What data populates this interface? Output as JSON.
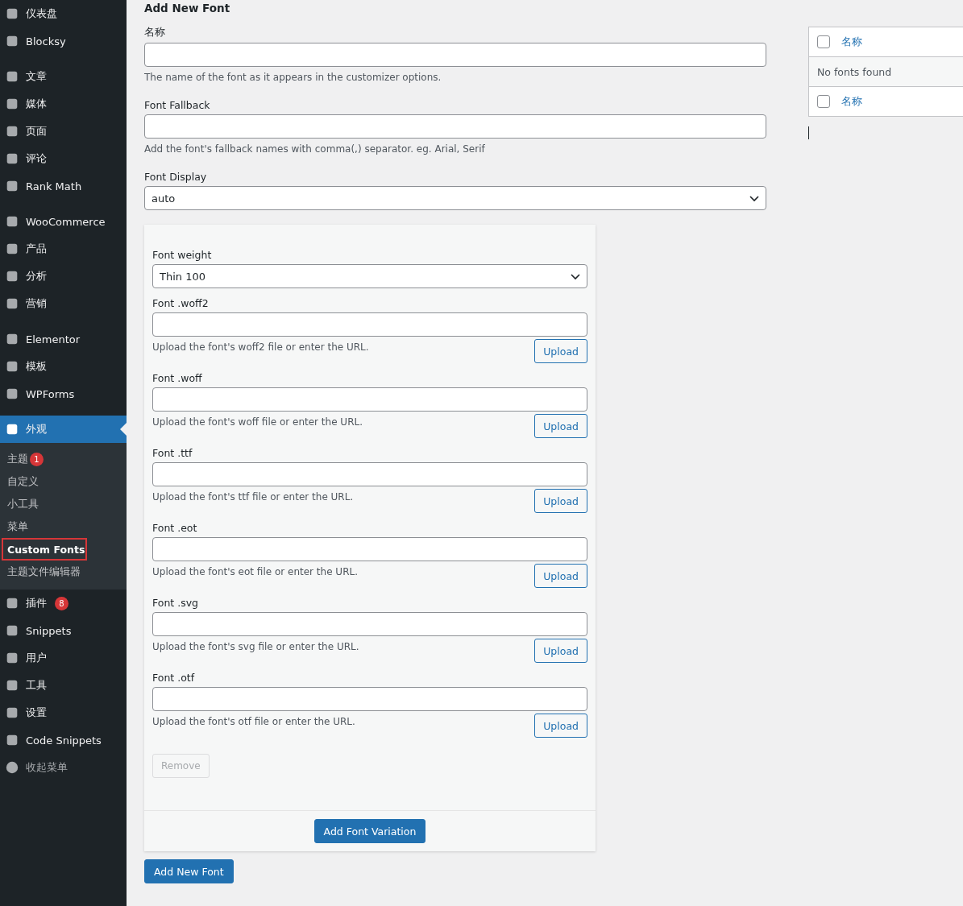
{
  "sidebar": {
    "groups": [
      [
        {
          "label": "仪表盘",
          "selected": false
        },
        {
          "label": "Blocksy",
          "selected": false
        }
      ],
      [
        {
          "label": "文章",
          "selected": false
        },
        {
          "label": "媒体",
          "selected": false
        },
        {
          "label": "页面",
          "selected": false
        },
        {
          "label": "评论",
          "selected": false
        },
        {
          "label": "Rank Math",
          "selected": false
        }
      ],
      [
        {
          "label": "WooCommerce",
          "selected": false
        },
        {
          "label": "产品",
          "selected": false
        },
        {
          "label": "分析",
          "selected": false
        },
        {
          "label": "营销",
          "selected": false
        }
      ],
      [
        {
          "label": "Elementor",
          "selected": false
        },
        {
          "label": "模板",
          "selected": false
        },
        {
          "label": "WPForms",
          "selected": false
        }
      ],
      [
        {
          "label": "外观",
          "selected": true,
          "children": [
            {
              "label": "主题",
              "badge": "1",
              "selected": false,
              "highlighted": false
            },
            {
              "label": "自定义",
              "selected": false,
              "highlighted": false
            },
            {
              "label": "小工具",
              "selected": false,
              "highlighted": false
            },
            {
              "label": "菜单",
              "selected": false,
              "highlighted": false
            },
            {
              "label": "Custom Fonts",
              "selected": true,
              "highlighted": true
            },
            {
              "label": "主题文件编辑器",
              "selected": false,
              "highlighted": false
            }
          ]
        },
        {
          "label": "插件",
          "badge": "8",
          "selected": false
        },
        {
          "label": "Snippets",
          "selected": false
        },
        {
          "label": "用户",
          "selected": false
        },
        {
          "label": "工具",
          "selected": false
        },
        {
          "label": "设置",
          "selected": false
        },
        {
          "label": "Code Snippets",
          "selected": false
        },
        {
          "label": "收起菜单",
          "selected": false,
          "muted": true
        }
      ]
    ]
  },
  "form": {
    "title": "Add New Font",
    "name": {
      "label": "名称",
      "help": "The name of the font as it appears in the customizer options."
    },
    "fallback": {
      "label": "Font Fallback",
      "help": "Add the font's fallback names with comma(,) separator. eg. Arial, Serif"
    },
    "display": {
      "label": "Font Display",
      "value": "auto"
    },
    "variation": {
      "weight_label": "Font weight",
      "weight_value": "Thin 100",
      "files": [
        {
          "label": "Font .woff2",
          "help": "Upload the font's woff2 file or enter the URL.",
          "button": "Upload"
        },
        {
          "label": "Font .woff",
          "help": "Upload the font's woff file or enter the URL.",
          "button": "Upload"
        },
        {
          "label": "Font .ttf",
          "help": "Upload the font's ttf file or enter the URL.",
          "button": "Upload"
        },
        {
          "label": "Font .eot",
          "help": "Upload the font's eot file or enter the URL.",
          "button": "Upload"
        },
        {
          "label": "Font .svg",
          "help": "Upload the font's svg file or enter the URL.",
          "button": "Upload"
        },
        {
          "label": "Font .otf",
          "help": "Upload the font's otf file or enter the URL.",
          "button": "Upload"
        }
      ],
      "remove": {
        "label": "Remove",
        "disabled": true
      },
      "add_variation": "Add Font Variation"
    },
    "submit": "Add New Font"
  },
  "fonts_table": {
    "header": {
      "label": "名称",
      "checked": false
    },
    "empty": "No fonts found",
    "footer": {
      "label": "名称",
      "checked": false
    }
  }
}
